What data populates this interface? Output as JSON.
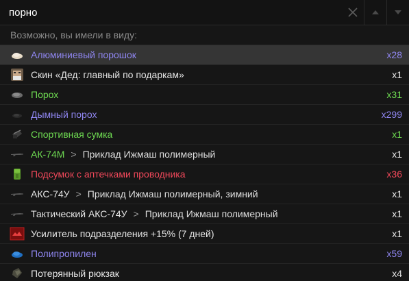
{
  "search": {
    "value": "порно",
    "clear_icon": "close-icon",
    "up_icon": "arrow-up-icon",
    "down_icon": "arrow-down-icon"
  },
  "hint": "Возможно, вы имели в виду:",
  "items": [
    {
      "name": "Алюминиевый порошок",
      "sub": "",
      "count": "x28",
      "color": "#8f86f0",
      "count_color": "#8f86f0",
      "icon": "powder-pile-icon",
      "selected": true
    },
    {
      "name": "Скин «Дед: главный по подаркам»",
      "sub": "",
      "count": "x1",
      "color": "#e6e6e6",
      "count_color": "#e6e6e6",
      "icon": "character-face-icon",
      "selected": false
    },
    {
      "name": "Порох",
      "sub": "",
      "count": "x31",
      "color": "#6fdc52",
      "count_color": "#6fdc52",
      "icon": "powder-icon",
      "selected": false
    },
    {
      "name": "Дымный порох",
      "sub": "",
      "count": "x299",
      "color": "#8f86f0",
      "count_color": "#8f86f0",
      "icon": "black-powder-icon",
      "selected": false
    },
    {
      "name": "Спортивная сумка",
      "sub": "",
      "count": "x1",
      "color": "#6fdc52",
      "count_color": "#6fdc52",
      "icon": "bag-icon",
      "selected": false
    },
    {
      "name": "АК-74М",
      "sub": "Приклад Ижмаш полимерный",
      "count": "x1",
      "color": "#6fdc52",
      "count_color": "#e6e6e6",
      "icon": "rifle-icon",
      "selected": false
    },
    {
      "name": "Подсумок с аптечками проводника",
      "sub": "",
      "count": "x36",
      "color": "#f0485a",
      "count_color": "#f0485a",
      "icon": "pouch-icon",
      "selected": false
    },
    {
      "name": "АКС-74У",
      "sub": "Приклад Ижмаш полимерный, зимний",
      "count": "x1",
      "color": "#e6e6e6",
      "count_color": "#e6e6e6",
      "icon": "rifle-icon",
      "selected": false
    },
    {
      "name": "Тактический АКС-74У",
      "sub": "Приклад Ижмаш полимерный",
      "count": "x1",
      "color": "#e6e6e6",
      "count_color": "#e6e6e6",
      "icon": "rifle-icon",
      "selected": false
    },
    {
      "name": "Усилитель подразделения +15% (7 дней)",
      "sub": "",
      "count": "x1",
      "color": "#e6e6e6",
      "count_color": "#e6e6e6",
      "icon": "booster-badge-icon",
      "selected": false
    },
    {
      "name": "Полипропилен",
      "sub": "",
      "count": "x59",
      "color": "#8f86f0",
      "count_color": "#8f86f0",
      "icon": "polymer-pile-icon",
      "selected": false
    },
    {
      "name": "Потерянный рюкзак",
      "sub": "",
      "count": "x4",
      "color": "#e6e6e6",
      "count_color": "#e6e6e6",
      "icon": "backpack-icon",
      "selected": false
    }
  ],
  "separator": ">"
}
